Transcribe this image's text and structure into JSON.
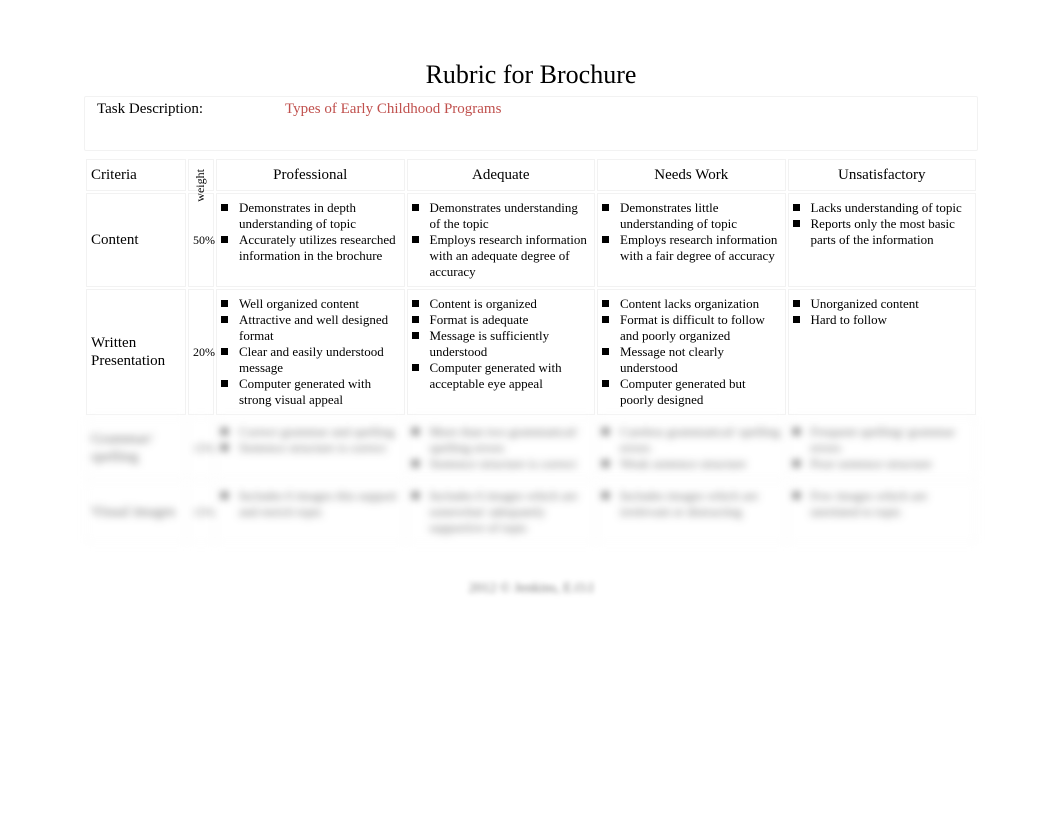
{
  "title": "Rubric for Brochure",
  "task_label": "Task Description:",
  "task_description": "Types of Early Childhood Programs",
  "headers": {
    "criteria": "Criteria",
    "weight": "weight",
    "levels": [
      "Professional",
      "Adequate",
      "Needs Work",
      "Unsatisfactory"
    ]
  },
  "rows": [
    {
      "criteria": "Content",
      "weight": "50%",
      "cells": [
        [
          "Demonstrates in depth understanding of topic",
          "Accurately utilizes researched information in the brochure"
        ],
        [
          "Demonstrates understanding of the topic",
          "Employs research information with an adequate degree of accuracy"
        ],
        [
          "Demonstrates little understanding of topic",
          "Employs research information with a fair degree of accuracy"
        ],
        [
          "Lacks understanding of topic",
          "Reports only the most basic parts of the information"
        ]
      ]
    },
    {
      "criteria": "Written Presentation",
      "weight": "20%",
      "cells": [
        [
          "Well organized content",
          "Attractive and well designed format",
          "Clear and easily understood message",
          "Computer generated with strong visual appeal"
        ],
        [
          "Content is organized",
          "Format is adequate",
          "Message is sufficiently understood",
          "Computer generated with acceptable eye appeal"
        ],
        [
          "Content lacks organization",
          "Format is difficult to follow and poorly organized",
          "Message not clearly understood",
          "Computer generated but poorly designed"
        ],
        [
          "Unorganized content",
          "Hard to follow"
        ]
      ]
    },
    {
      "criteria": "Grammar/ spelling",
      "weight": "15%",
      "blurred": true,
      "cells": [
        [
          "Correct grammar and spelling",
          "Sentence structure is correct"
        ],
        [
          "More than two grammatical/ spelling errors",
          "Sentence structure is correct"
        ],
        [
          "Careless grammatical/ spelling errors",
          "Weak sentence structure"
        ],
        [
          "Frequent spelling/ grammar errors",
          "Poor sentence structure"
        ]
      ]
    },
    {
      "criteria": "Visual images",
      "weight": "15%",
      "blurred": true,
      "cells": [
        [
          "Includes 6 images this support and enrich topic"
        ],
        [
          "Includes 6 images which are somewhat/ adequately supportive of topic"
        ],
        [
          "Includes images which are irrelevant or distracting"
        ],
        [
          "Few images which are unrelated to topic"
        ]
      ]
    }
  ],
  "footer": "2012 © Jenkins, E.O.I"
}
